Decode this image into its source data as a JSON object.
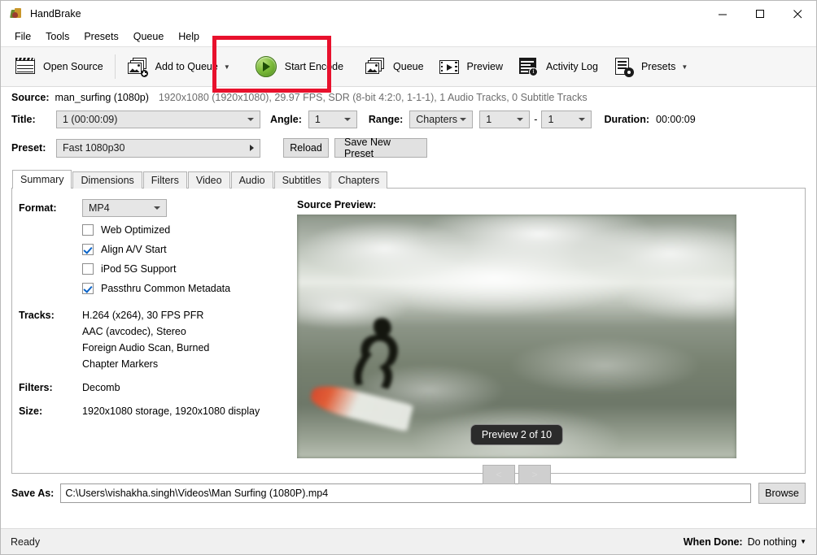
{
  "window": {
    "title": "HandBrake",
    "app_icon": "handbrake-pineapple-icon",
    "minimize": "minimize-icon",
    "maximize": "maximize-icon",
    "close": "close-icon"
  },
  "menu": [
    {
      "label": "File"
    },
    {
      "label": "Tools"
    },
    {
      "label": "Presets"
    },
    {
      "label": "Queue"
    },
    {
      "label": "Help"
    }
  ],
  "toolbar": {
    "open_source": "Open Source",
    "add_to_queue": "Add to Queue",
    "start_encode": "Start Encode",
    "queue": "Queue",
    "preview": "Preview",
    "activity_log": "Activity Log",
    "presets": "Presets",
    "highlight_color": "#e8112d"
  },
  "source": {
    "label": "Source:",
    "name": "man_surfing (1080p)",
    "meta": "1920x1080 (1920x1080), 29.97 FPS, SDR (8-bit 4:2:0, 1-1-1), 1 Audio Tracks, 0 Subtitle Tracks"
  },
  "title_row": {
    "title_label": "Title:",
    "title_value": "1 (00:00:09)",
    "angle_label": "Angle:",
    "angle_value": "1",
    "range_label": "Range:",
    "range_value": "Chapters",
    "range_start": "1",
    "range_dash": "-",
    "range_end": "1",
    "duration_label": "Duration:",
    "duration_value": "00:00:09"
  },
  "preset_row": {
    "label": "Preset:",
    "value": "Fast 1080p30",
    "reload": "Reload",
    "save_new_preset": "Save New Preset"
  },
  "tabs": [
    {
      "label": "Summary",
      "active": true
    },
    {
      "label": "Dimensions",
      "active": false
    },
    {
      "label": "Filters",
      "active": false
    },
    {
      "label": "Video",
      "active": false
    },
    {
      "label": "Audio",
      "active": false
    },
    {
      "label": "Subtitles",
      "active": false
    },
    {
      "label": "Chapters",
      "active": false
    }
  ],
  "summary": {
    "format_label": "Format:",
    "format_value": "MP4",
    "checkboxes": [
      {
        "label": "Web Optimized",
        "checked": false
      },
      {
        "label": "Align A/V Start",
        "checked": true
      },
      {
        "label": "iPod 5G Support",
        "checked": false
      },
      {
        "label": "Passthru Common Metadata",
        "checked": true
      }
    ],
    "tracks_label": "Tracks:",
    "tracks": [
      "H.264 (x264), 30 FPS PFR",
      "AAC (avcodec), Stereo",
      "Foreign Audio Scan, Burned",
      "Chapter Markers"
    ],
    "filters_label": "Filters:",
    "filters_value": "Decomb",
    "size_label": "Size:",
    "size_value": "1920x1080 storage, 1920x1080 display"
  },
  "preview": {
    "title": "Source Preview:",
    "overlay_label": "Preview 2 of 10",
    "prev_button": "<",
    "next_button": ">"
  },
  "save_as": {
    "label": "Save As:",
    "path": "C:\\Users\\vishakha.singh\\Videos\\Man Surfing (1080P).mp4",
    "browse": "Browse"
  },
  "status": {
    "state": "Ready",
    "when_done_label": "When Done:",
    "when_done_value": "Do nothing"
  }
}
